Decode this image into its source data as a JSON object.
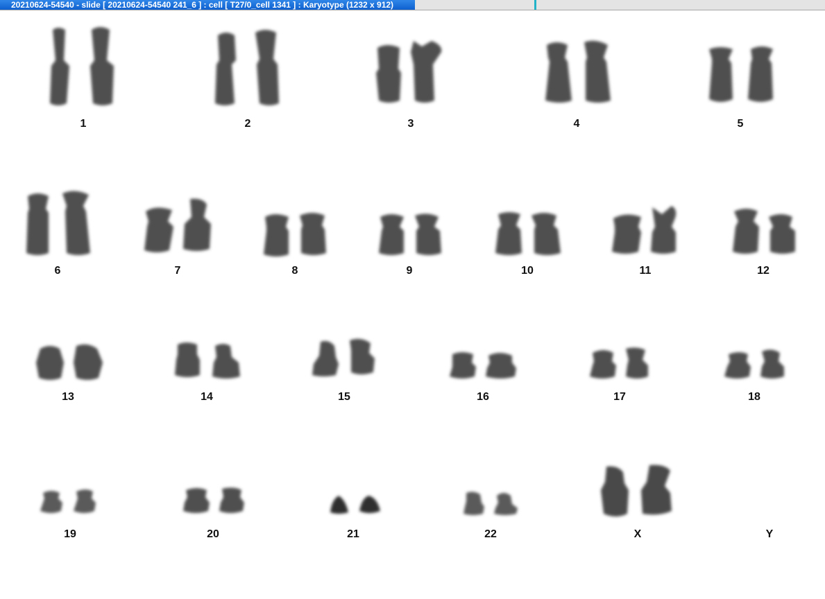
{
  "window": {
    "title": "20210624-54540 - slide [ 20210624-54540 241_6 ] : cell [ T27/0_cell 1341 ] : Karyotype  (1232 x 912)"
  },
  "colors": {
    "title_bar": "#1a6fdc",
    "title_text": "#ffffff",
    "chromosome": "#4a4a4a",
    "background": "#ffffff"
  },
  "karyotype": {
    "chromosomes": [
      {
        "id": "1",
        "label": "1",
        "count": 2
      },
      {
        "id": "2",
        "label": "2",
        "count": 2
      },
      {
        "id": "3",
        "label": "3",
        "count": 2
      },
      {
        "id": "4",
        "label": "4",
        "count": 2
      },
      {
        "id": "5",
        "label": "5",
        "count": 2
      },
      {
        "id": "6",
        "label": "6",
        "count": 2
      },
      {
        "id": "7",
        "label": "7",
        "count": 2
      },
      {
        "id": "8",
        "label": "8",
        "count": 2
      },
      {
        "id": "9",
        "label": "9",
        "count": 2
      },
      {
        "id": "10",
        "label": "10",
        "count": 2
      },
      {
        "id": "11",
        "label": "11",
        "count": 2
      },
      {
        "id": "12",
        "label": "12",
        "count": 2
      },
      {
        "id": "13",
        "label": "13",
        "count": 2
      },
      {
        "id": "14",
        "label": "14",
        "count": 2
      },
      {
        "id": "15",
        "label": "15",
        "count": 2
      },
      {
        "id": "16",
        "label": "16",
        "count": 2
      },
      {
        "id": "17",
        "label": "17",
        "count": 2
      },
      {
        "id": "18",
        "label": "18",
        "count": 2
      },
      {
        "id": "19",
        "label": "19",
        "count": 2
      },
      {
        "id": "20",
        "label": "20",
        "count": 2
      },
      {
        "id": "21",
        "label": "21",
        "count": 2
      },
      {
        "id": "22",
        "label": "22",
        "count": 2
      },
      {
        "id": "X",
        "label": "X",
        "count": 2
      },
      {
        "id": "Y",
        "label": "Y",
        "count": 0
      }
    ]
  }
}
